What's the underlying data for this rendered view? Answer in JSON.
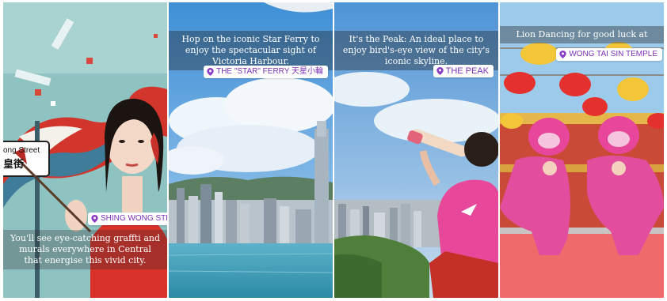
{
  "stories": [
    {
      "caption": "You'll see eye-catching graffti and murals everywhere in Central that energise this vivid city.",
      "location": "SHING WONG STREET",
      "sign_text_1": "ong Street",
      "sign_text_2": "皇街"
    },
    {
      "caption": "Hop on the iconic Star Ferry to enjoy the spectacular sight of Victoria Harbour.",
      "location": "THE \"STAR\" FERRY 天星小輪"
    },
    {
      "caption": "It's the Peak: An ideal place to enjoy bird's-eye view of the city's iconic skyline.",
      "location": "THE PEAK"
    },
    {
      "caption": "Lion Dancing for good luck at",
      "location": "WONG TAI SIN TEMPLE"
    }
  ],
  "colors": {
    "location_text": "#7b2fb5",
    "location_pin": "#8a3cc4"
  },
  "icons": {
    "location_pin": "map-pin-icon"
  }
}
